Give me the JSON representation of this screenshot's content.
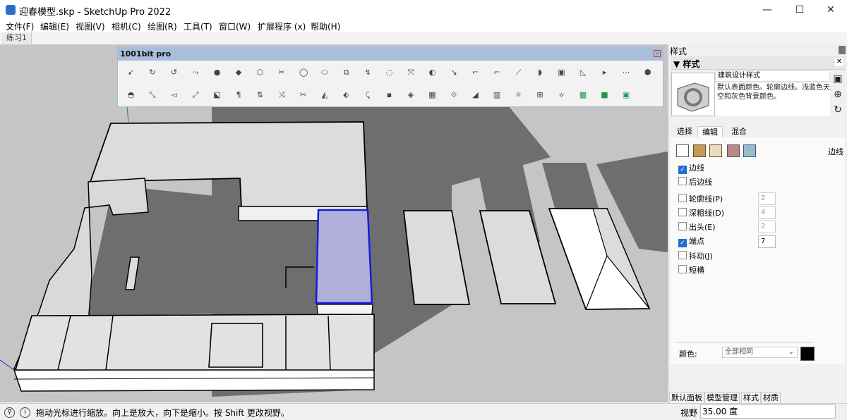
{
  "window": {
    "title": "迎春模型.skp - SketchUp Pro 2022",
    "minimize": "—",
    "maximize": "☐",
    "close": "✕"
  },
  "menu": [
    "文件(F)",
    "编辑(E)",
    "视图(V)",
    "相机(C)",
    "绘图(R)",
    "工具(T)",
    "窗口(W)",
    "扩展程序 (x)",
    "帮助(H)"
  ],
  "scene_tab": "练习1",
  "toolbar": {
    "title": "1001bit pro"
  },
  "tray": {
    "title": "样式",
    "panel_title": "▼ 样式",
    "style_name": "建筑设计样式",
    "style_desc": "默认表面颜色。轮廓边线。浅蓝色天空和灰色背景颜色。",
    "tabs": [
      "选择",
      "编辑",
      "混合"
    ],
    "edit_section_label": "边线",
    "options": [
      {
        "label": "边线",
        "checked": true
      },
      {
        "label": "后边线",
        "checked": false
      },
      {
        "label": "轮廓线(P)",
        "checked": false,
        "value": "2"
      },
      {
        "label": "深粗线(D)",
        "checked": false,
        "value": "4"
      },
      {
        "label": "出头(E)",
        "checked": false,
        "value": "2"
      },
      {
        "label": "端点",
        "checked": true,
        "value": "7"
      },
      {
        "label": "抖动(J)",
        "checked": false
      },
      {
        "label": "短横",
        "checked": false
      }
    ],
    "color_label": "颜色:",
    "color_value": "全部相同",
    "edge_color": "#000000"
  },
  "tray_tabs": [
    "默认面板",
    "模型管理",
    "样式",
    "材质"
  ],
  "status": {
    "message": "拖动光标进行缩放。向上是放大，向下是缩小。按 Shift 更改视野。",
    "fov_label": "视野",
    "fov_value": "35.00 度"
  },
  "colors": {
    "selection": "#1a1adc",
    "shadow": "#6c6c6c",
    "ground": "#c5c5c5"
  }
}
